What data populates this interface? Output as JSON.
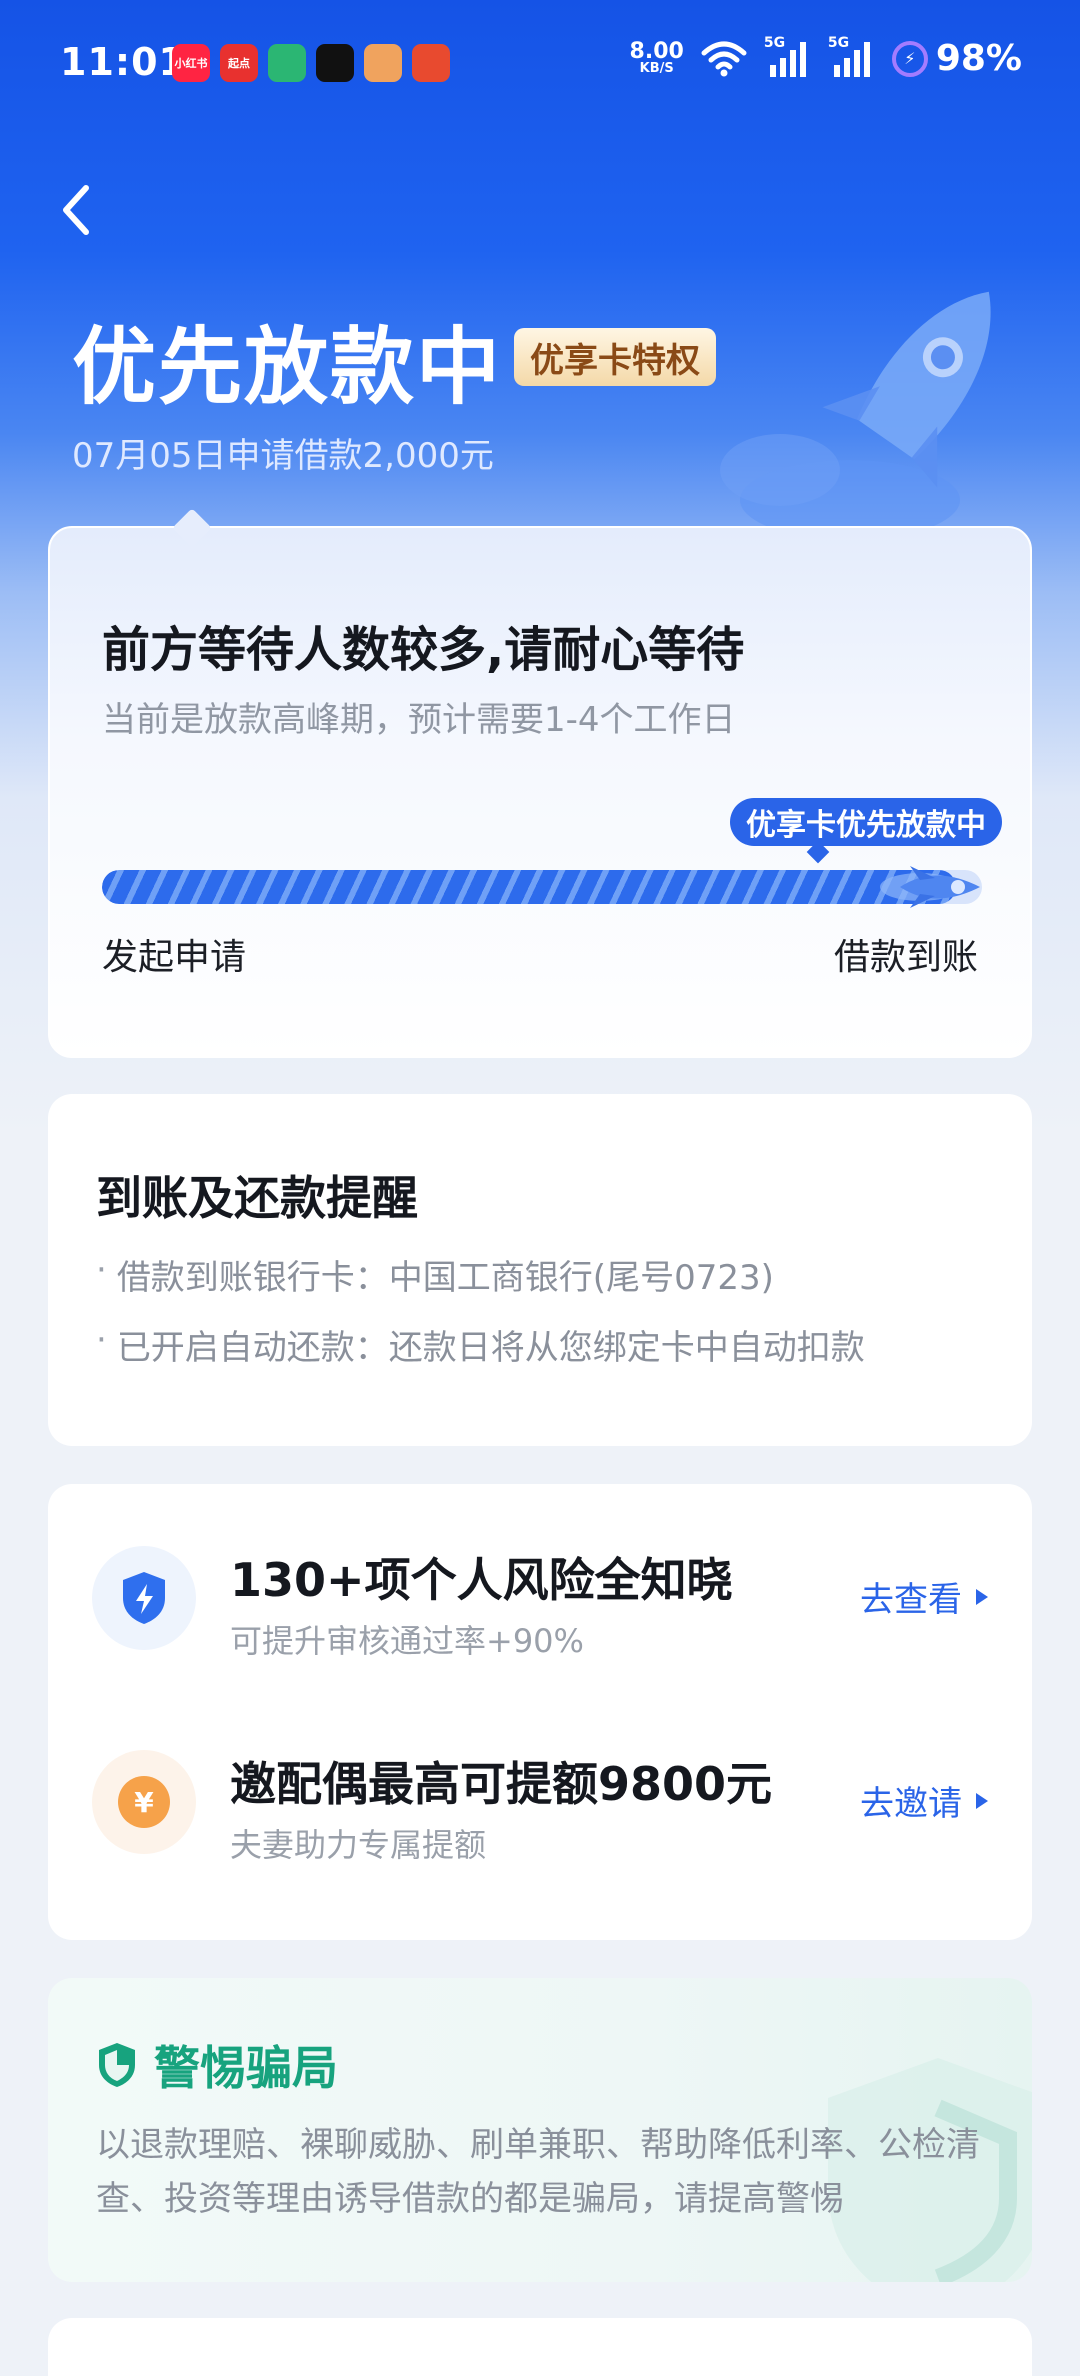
{
  "status_bar": {
    "time": "11:01",
    "apps": [
      {
        "name": "xiaohongshu-app-icon",
        "label": "小红书",
        "color": "#ff2442"
      },
      {
        "name": "qidian-app-icon",
        "label": "起点",
        "color": "#e8312f"
      },
      {
        "name": "home-app-icon",
        "label": "",
        "color": "#2bb673"
      },
      {
        "name": "tiktok-app-icon",
        "label": "",
        "color": "#111111"
      },
      {
        "name": "game-app-icon",
        "label": "",
        "color": "#f0a35e"
      },
      {
        "name": "red-app-icon",
        "label": "",
        "color": "#e84a2f"
      }
    ],
    "net_speed": "8.00",
    "net_unit": "KB/S",
    "signal_1": "5G",
    "signal_2": "5G",
    "battery": "98%"
  },
  "header": {
    "title": "优先放款中",
    "badge": "优享卡特权",
    "subtitle": "07月05日申请借款2,000元"
  },
  "progress": {
    "title": "前方等待人数较多,请耐心等待",
    "description": "当前是放款高峰期，预计需要1-4个工作日",
    "bubble": "优享卡优先放款中",
    "start_label": "发起申请",
    "end_label": "借款到账",
    "fill_fraction": 0.97
  },
  "reminder": {
    "title": "到账及还款提醒",
    "items": [
      "借款到账银行卡：中国工商银行(尾号0723)",
      "已开启自动还款：还款日将从您绑定卡中自动扣款"
    ]
  },
  "promos": [
    {
      "icon": "shield-lightning-icon",
      "title": "130+项个人风险全知晓",
      "subtitle": "可提升审核通过率+90%",
      "link": "去查看"
    },
    {
      "icon": "yen-coin-icon",
      "title": "邀配偶最高可提额9800元",
      "subtitle": "夫妻助力专属提额",
      "link": "去邀请"
    }
  ],
  "fraud": {
    "title": "警惕骗局",
    "text": "以退款理赔、裸聊威胁、刷单兼职、帮助降低利率、公检清查、投资等理由诱导借款的都是骗局，请提高警惕"
  }
}
